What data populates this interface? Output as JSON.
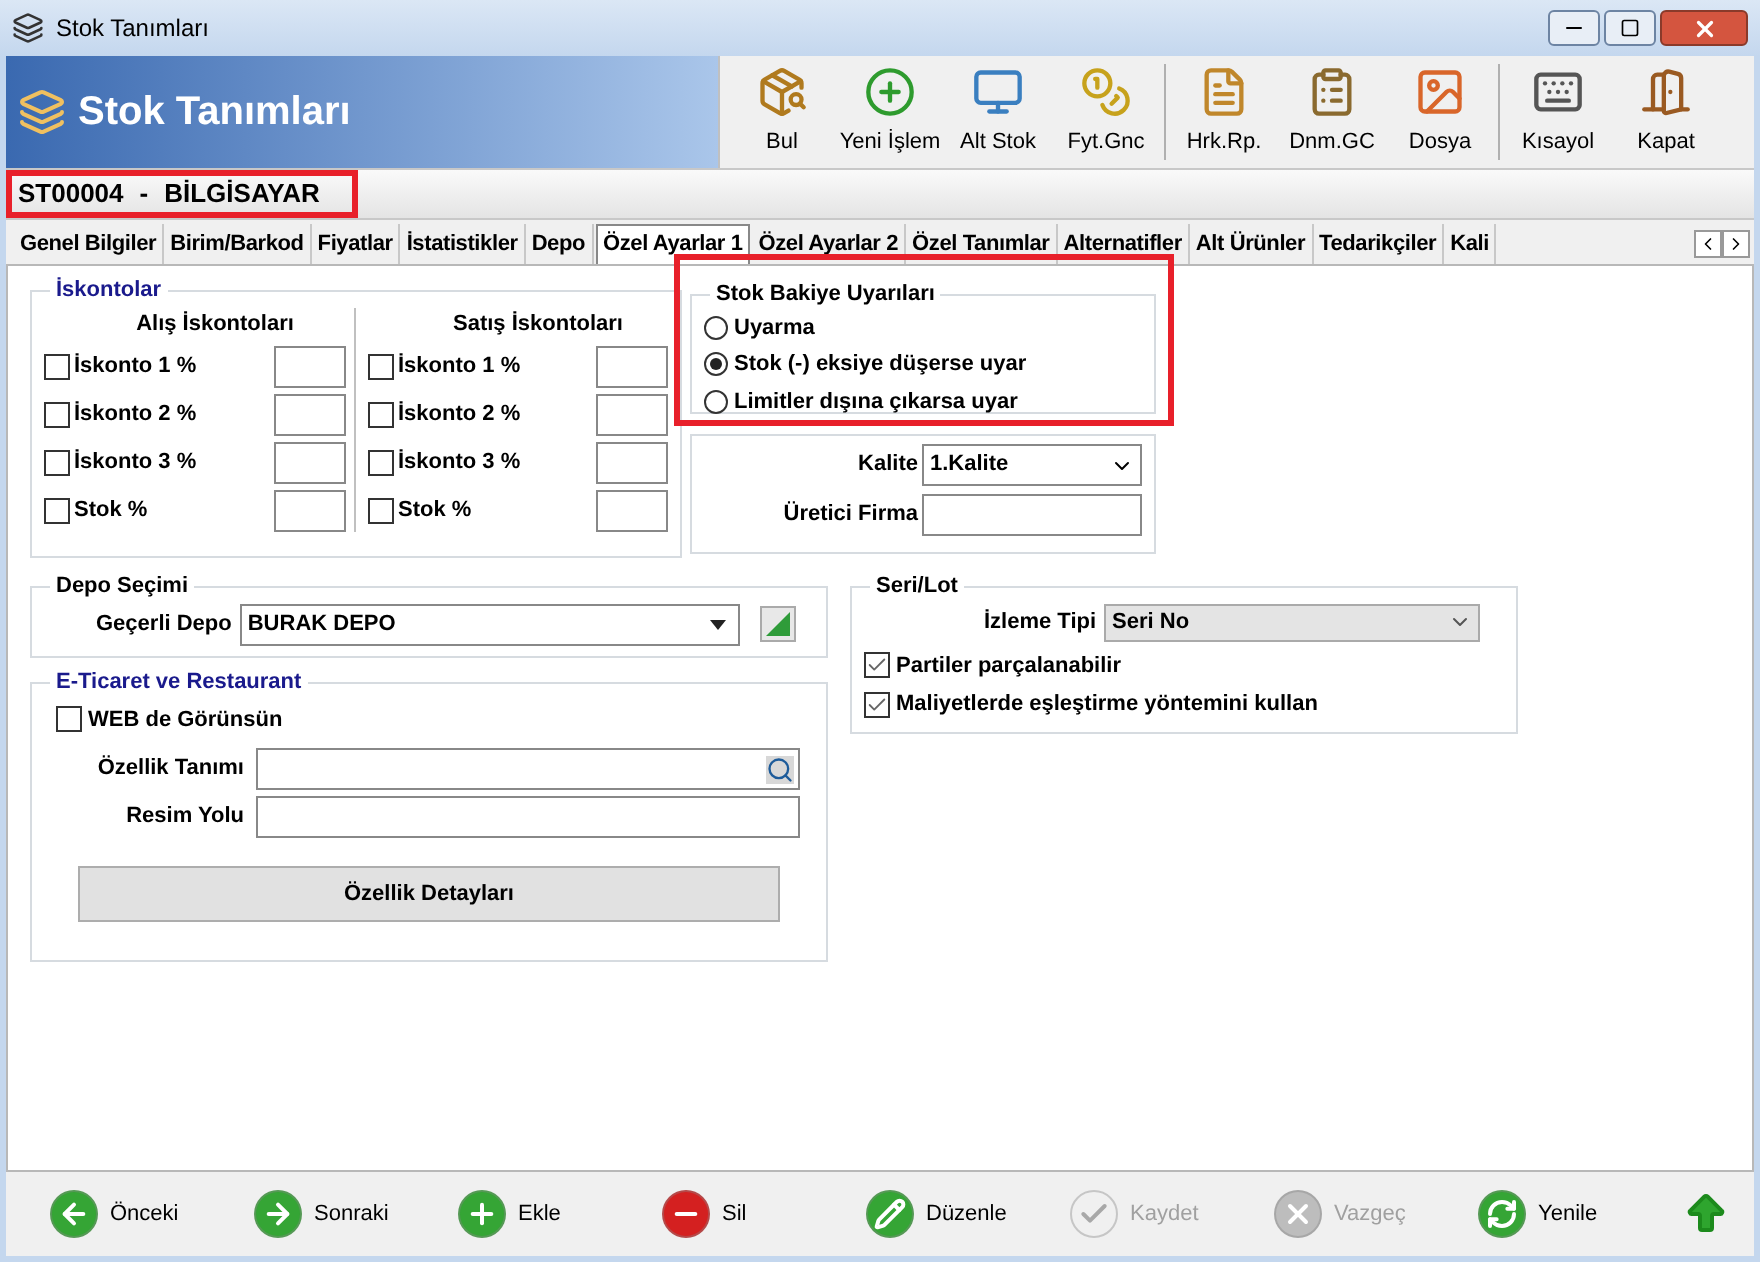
{
  "window": {
    "title": "Stok Tanımları"
  },
  "header": {
    "title": "Stok Tanımları"
  },
  "toolbar": [
    {
      "label": "Bul"
    },
    {
      "label": "Yeni İşlem"
    },
    {
      "label": "Alt Stok"
    },
    {
      "label": "Fyt.Gnc"
    },
    {
      "label": "Hrk.Rp."
    },
    {
      "label": "Dnm.GC"
    },
    {
      "label": "Dosya"
    },
    {
      "label": "Kısayol"
    },
    {
      "label": "Kapat"
    }
  ],
  "record": {
    "code": "ST00004",
    "separator": "-",
    "name": "BİLGİSAYAR"
  },
  "tabs": [
    {
      "label": "Genel Bilgiler",
      "selected": false
    },
    {
      "label": "Birim/Barkod",
      "selected": false
    },
    {
      "label": "Fiyatlar",
      "selected": false
    },
    {
      "label": "İstatistikler",
      "selected": false
    },
    {
      "label": "Depo",
      "selected": false
    },
    {
      "label": "Özel Ayarlar 1",
      "selected": true
    },
    {
      "label": "Özel Ayarlar 2",
      "selected": false
    },
    {
      "label": "Özel Tanımlar",
      "selected": false
    },
    {
      "label": "Alternatifler",
      "selected": false
    },
    {
      "label": "Alt Ürünler",
      "selected": false
    },
    {
      "label": "Tedarikçiler",
      "selected": false
    },
    {
      "label": "Kali",
      "selected": false
    }
  ],
  "discounts": {
    "title": "İskontolar",
    "columns": [
      {
        "title": "Alış İskontoları",
        "items": [
          {
            "label": "İskonto 1 %",
            "checked": false
          },
          {
            "label": "İskonto 2 %",
            "checked": false
          },
          {
            "label": "İskonto 3 %",
            "checked": false
          },
          {
            "label": "Stok %",
            "checked": false
          }
        ]
      },
      {
        "title": "Satış İskontoları",
        "items": [
          {
            "label": "İskonto 1 %",
            "checked": false
          },
          {
            "label": "İskonto 2 %",
            "checked": false
          },
          {
            "label": "İskonto 3 %",
            "checked": false
          },
          {
            "label": "Stok %",
            "checked": false
          }
        ]
      }
    ]
  },
  "stock_warnings": {
    "title": "Stok Bakiye Uyarıları",
    "options": [
      {
        "label": "Uyarma",
        "selected": false
      },
      {
        "label": "Stok (-) eksiye düşerse uyar",
        "selected": true
      },
      {
        "label": "Limitler dışına çıkarsa uyar",
        "selected": false
      }
    ]
  },
  "quality": {
    "quality_label": "Kalite",
    "quality_value": "1.Kalite",
    "manufacturer_label": "Üretici Firma"
  },
  "warehouse": {
    "title": "Depo Seçimi",
    "label": "Geçerli Depo",
    "value": "BURAK DEPO"
  },
  "ecommerce": {
    "title": "E-Ticaret ve Restaurant",
    "web_visible": {
      "label": "WEB de Görünsün",
      "checked": false
    },
    "fields": [
      {
        "label": "Özellik Tanımı",
        "kind": "lookup"
      },
      {
        "label": "Resim Yolu",
        "kind": "text"
      }
    ],
    "button": "Özellik Detayları"
  },
  "serial_lot": {
    "title": "Seri/Lot",
    "tracking_label": "İzleme Tipi",
    "tracking_value": "Seri No",
    "options": [
      {
        "label": "Partiler parçalanabilir",
        "checked": true
      },
      {
        "label": "Maliyetlerde eşleştirme yöntemini kullan",
        "checked": true
      }
    ]
  },
  "bottom_toolbar": [
    {
      "label": "Önceki",
      "disabled": false
    },
    {
      "label": "Sonraki",
      "disabled": false
    },
    {
      "label": "Ekle",
      "disabled": false
    },
    {
      "label": "Sil",
      "disabled": false
    },
    {
      "label": "Düzenle",
      "disabled": false
    },
    {
      "label": "Kaydet",
      "disabled": true
    },
    {
      "label": "Vazgeç",
      "disabled": true
    },
    {
      "label": "Yenile",
      "disabled": false
    }
  ]
}
